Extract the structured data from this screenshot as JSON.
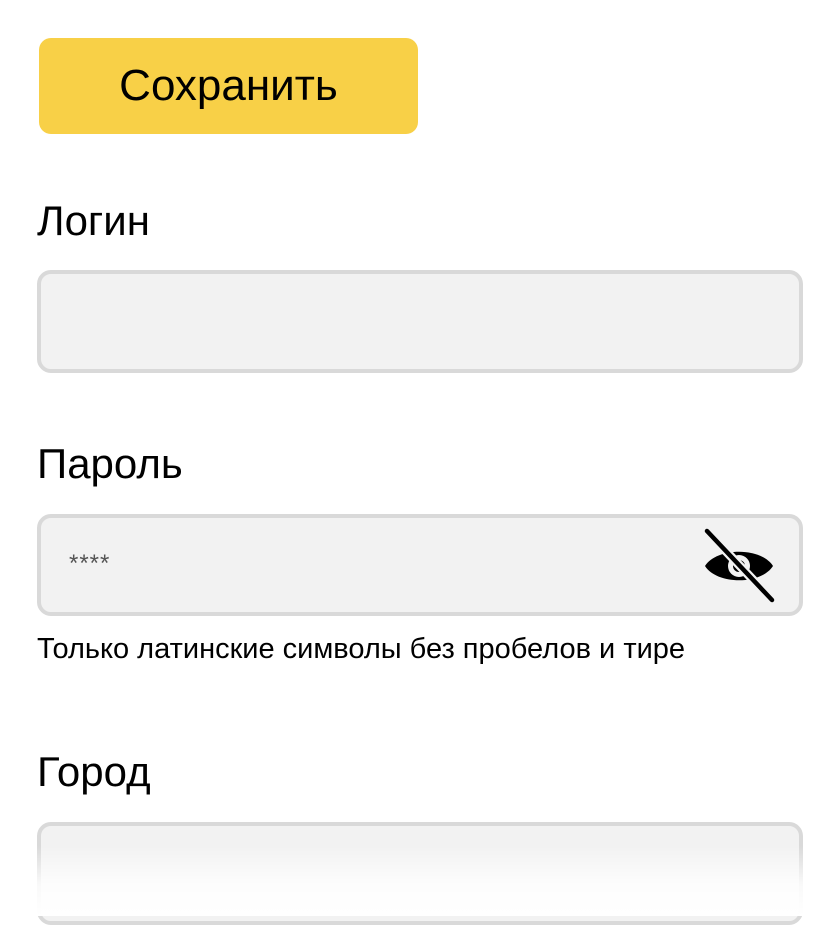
{
  "toolbar": {
    "save_label": "Сохранить"
  },
  "form": {
    "login": {
      "label": "Логин",
      "value": ""
    },
    "password": {
      "label": "Пароль",
      "masked_value": "****",
      "hint": "Только латинские символы без пробелов и тире",
      "visibility_icon": "eye-slash-icon"
    },
    "city": {
      "label": "Город",
      "value": ""
    }
  },
  "colors": {
    "accent": "#f8d047",
    "field_background": "#f2f2f2",
    "field_border": "#d9d9d9"
  }
}
